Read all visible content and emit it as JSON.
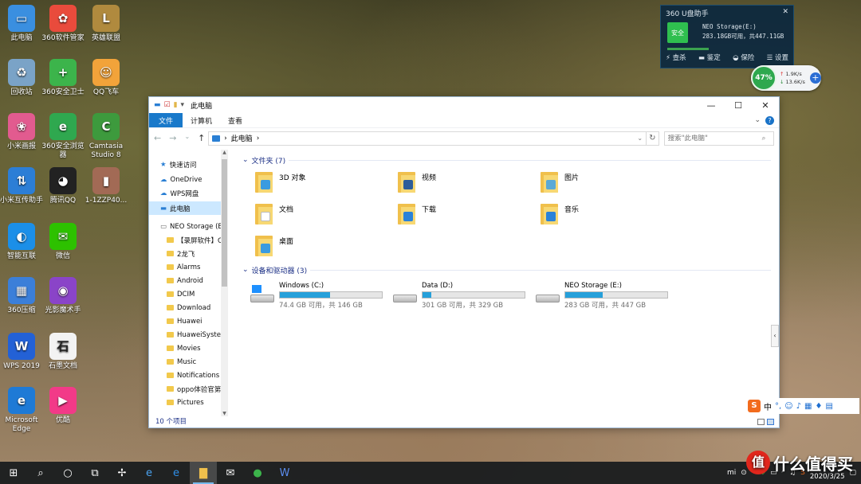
{
  "desktop_icons": [
    {
      "label": "此电脑",
      "color": "#3a8fe0",
      "glyph": "▭"
    },
    {
      "label": "360软件管家",
      "color": "#e94b3c",
      "glyph": "✿"
    },
    {
      "label": "英雄联盟",
      "color": "#b08a3e",
      "glyph": "L"
    },
    {
      "label": "回收站",
      "color": "#7aa3c7",
      "glyph": "♻"
    },
    {
      "label": "360安全卫士",
      "color": "#3cb44b",
      "glyph": "+"
    },
    {
      "label": "QQ飞车",
      "color": "#f2a33a",
      "glyph": "☺"
    },
    {
      "label": "小米画报",
      "color": "#e25b8f",
      "glyph": "❀"
    },
    {
      "label": "360安全浏览器",
      "color": "#2fa84f",
      "glyph": "e"
    },
    {
      "label": "Camtasia Studio 8",
      "color": "#3d9a3d",
      "glyph": "C"
    },
    {
      "label": "小米互传助手",
      "color": "#2c7ed6",
      "glyph": "⇅"
    },
    {
      "label": "腾讯QQ",
      "color": "#222222",
      "glyph": "◕"
    },
    {
      "label": "1-1ZZP40...",
      "color": "#a26a55",
      "glyph": "▮"
    },
    {
      "label": "智能互联",
      "color": "#1b8fe8",
      "glyph": "◐"
    },
    {
      "label": "微信",
      "color": "#2dc100",
      "glyph": "✉"
    },
    {
      "label": "360压缩",
      "color": "#3b7fd9",
      "glyph": "▦"
    },
    {
      "label": "光影魔术手",
      "color": "#8a44c8",
      "glyph": "◉"
    },
    {
      "label": "WPS 2019",
      "color": "#2361d6",
      "glyph": "W"
    },
    {
      "label": "石墨文档",
      "color": "#f3f3f3",
      "glyph": "石"
    },
    {
      "label": "Microsoft Edge",
      "color": "#1e7ad6",
      "glyph": "e"
    },
    {
      "label": "优酷",
      "color": "#f23a88",
      "glyph": "▶"
    }
  ],
  "widget360": {
    "title": "360 U盘助手",
    "safe_label": "安全",
    "drive_name": "NEO Storage(E:)",
    "drive_usage": "283.18GB可用，共447.11GB",
    "actions": [
      "查杀",
      "鉴定",
      "保险",
      "设置"
    ]
  },
  "speed_ball": {
    "percent": "47%",
    "up": "1.9K/s",
    "down": "13.6K/s"
  },
  "explorer": {
    "quick_access_arrow": "▾",
    "title": "此电脑",
    "ribbon_tabs": [
      "文件",
      "计算机",
      "查看"
    ],
    "address": [
      "此电脑"
    ],
    "address_sep": "›",
    "search_placeholder": "搜索\"此电脑\"",
    "sidebar": [
      {
        "label": "快速访问",
        "icon": "star-icon",
        "child": false
      },
      {
        "label": "OneDrive",
        "icon": "cloud-icon",
        "child": false
      },
      {
        "label": "WPS网盘",
        "icon": "cloud-icon",
        "child": false
      },
      {
        "label": "此电脑",
        "icon": "computer-icon",
        "child": false,
        "selected": true
      },
      {
        "label": "NEO Storage (E:)",
        "icon": "drive-icon",
        "child": false
      },
      {
        "label": "【录屏软件】Ca",
        "icon": "folder-icon",
        "child": true
      },
      {
        "label": "2龙飞",
        "icon": "folder-icon",
        "child": true
      },
      {
        "label": "Alarms",
        "icon": "folder-icon",
        "child": true
      },
      {
        "label": "Android",
        "icon": "folder-icon",
        "child": true
      },
      {
        "label": "DCIM",
        "icon": "folder-icon",
        "child": true
      },
      {
        "label": "Download",
        "icon": "folder-icon",
        "child": true
      },
      {
        "label": "Huawei",
        "icon": "folder-icon",
        "child": true
      },
      {
        "label": "HuaweiSystem",
        "icon": "folder-icon",
        "child": true
      },
      {
        "label": "Movies",
        "icon": "folder-icon",
        "child": true
      },
      {
        "label": "Music",
        "icon": "folder-icon",
        "child": true
      },
      {
        "label": "Notifications",
        "icon": "folder-icon",
        "child": true
      },
      {
        "label": "oppo体验官第二",
        "icon": "folder-icon",
        "child": true
      },
      {
        "label": "Pictures",
        "icon": "folder-icon",
        "child": true
      }
    ],
    "folders_header": "文件夹 (7)",
    "folders": [
      {
        "name": "3D 对象",
        "badge": "#3a9be0"
      },
      {
        "name": "视频",
        "badge": "#2d5d9a"
      },
      {
        "name": "图片",
        "badge": "#5aa9d6"
      },
      {
        "name": "文档",
        "badge": "#ffffff"
      },
      {
        "name": "下载",
        "badge": "#2a82d9"
      },
      {
        "name": "音乐",
        "badge": "#2a82d9"
      },
      {
        "name": "桌面",
        "badge": "#3a9be0"
      }
    ],
    "drives_header": "设备和驱动器 (3)",
    "drives": [
      {
        "name": "Windows (C:)",
        "detail": "74.4 GB 可用，共 146 GB",
        "used_fraction": 0.49,
        "windows": true
      },
      {
        "name": "Data (D:)",
        "detail": "301 GB 可用，共 329 GB",
        "used_fraction": 0.085,
        "windows": false
      },
      {
        "name": "NEO Storage (E:)",
        "detail": "283 GB 可用，共 447 GB",
        "used_fraction": 0.37,
        "windows": false
      }
    ],
    "status": "10 个项目"
  },
  "ime": {
    "logo": "S",
    "lang": "中"
  },
  "taskbar": {
    "date": "2020/3/25"
  },
  "brand": {
    "text": "什么值得买",
    "logo": "值"
  }
}
